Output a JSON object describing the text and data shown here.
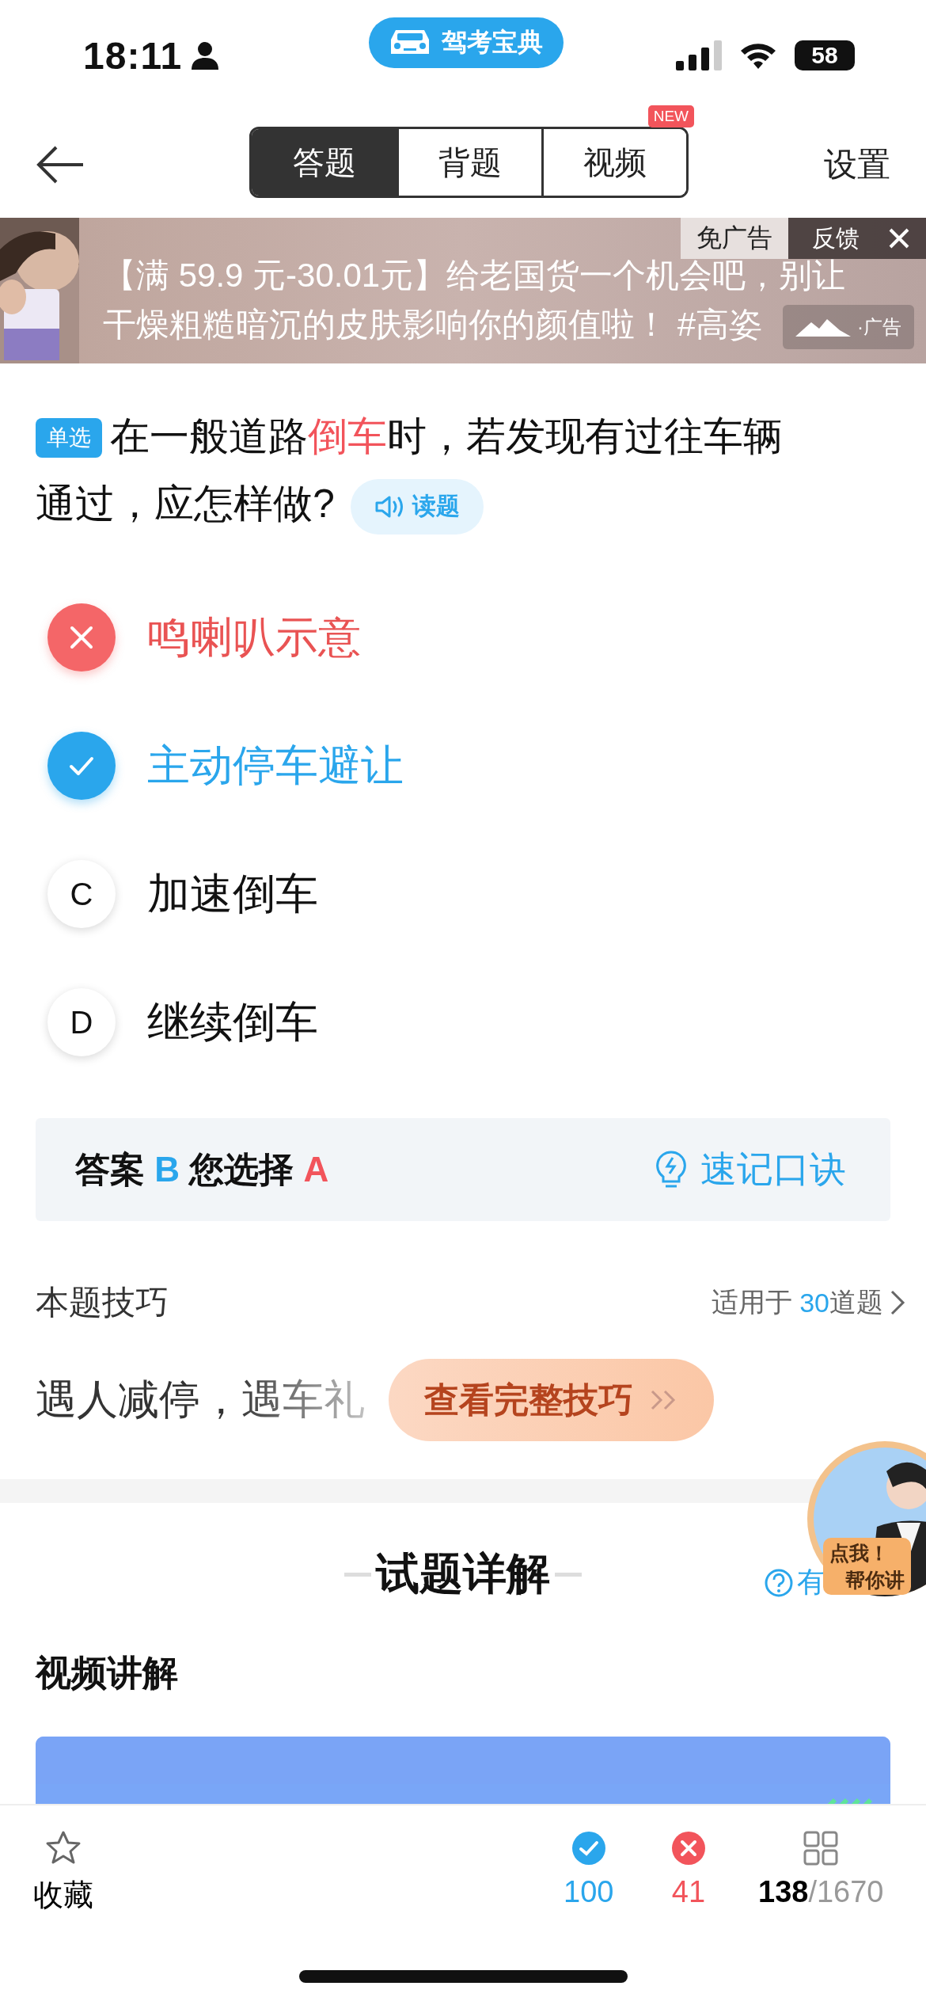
{
  "status_bar": {
    "time": "18:11",
    "app_badge": "驾考宝典",
    "battery": "58"
  },
  "header": {
    "tabs": [
      {
        "label": "答题",
        "selected": true
      },
      {
        "label": "背题",
        "selected": false
      },
      {
        "label": "视频",
        "selected": false,
        "badge": "NEW"
      }
    ],
    "settings": "设置"
  },
  "ad": {
    "close_ad": "免广告",
    "feedback": "反馈",
    "lines": [
      "【满 59.9 元-30.01元】给老国货一个机会吧，别让",
      "干燥粗糙暗沉的皮肤影响你的颜值啦！ #高姿"
    ],
    "ad_label": "·广告"
  },
  "question": {
    "type_tag": "单选",
    "text_before": "在一般道路",
    "highlight": "倒车",
    "text_after": "时，若发现有过往车辆通过，应怎样做?",
    "read_button": "读题"
  },
  "options": [
    {
      "kind": "wrong",
      "text": "鸣喇叭示意"
    },
    {
      "kind": "correct",
      "text": "主动停车避让"
    },
    {
      "kind": "plain",
      "letter": "C",
      "text": "加速倒车"
    },
    {
      "kind": "plain",
      "letter": "D",
      "text": "继续倒车"
    }
  ],
  "answer_bar": {
    "answer_label": "答案",
    "answer": "B",
    "choice_label": "您选择",
    "choice": "A",
    "mnemonic": "速记口诀"
  },
  "tip": {
    "title": "本题技巧",
    "applies_before": "适用于",
    "applies_count": "30",
    "applies_after": "道题",
    "text": "遇人减停，遇车礼",
    "button": "查看完整技巧"
  },
  "explanation": {
    "title": "试题详解",
    "help": "有",
    "avatar_caption": [
      "点我！",
      "帮你讲"
    ],
    "video_title": "视频讲解"
  },
  "bottom_bar": {
    "favorite": "收藏",
    "correct_count": "100",
    "wrong_count": "41",
    "current": "138",
    "total": "/1670"
  }
}
